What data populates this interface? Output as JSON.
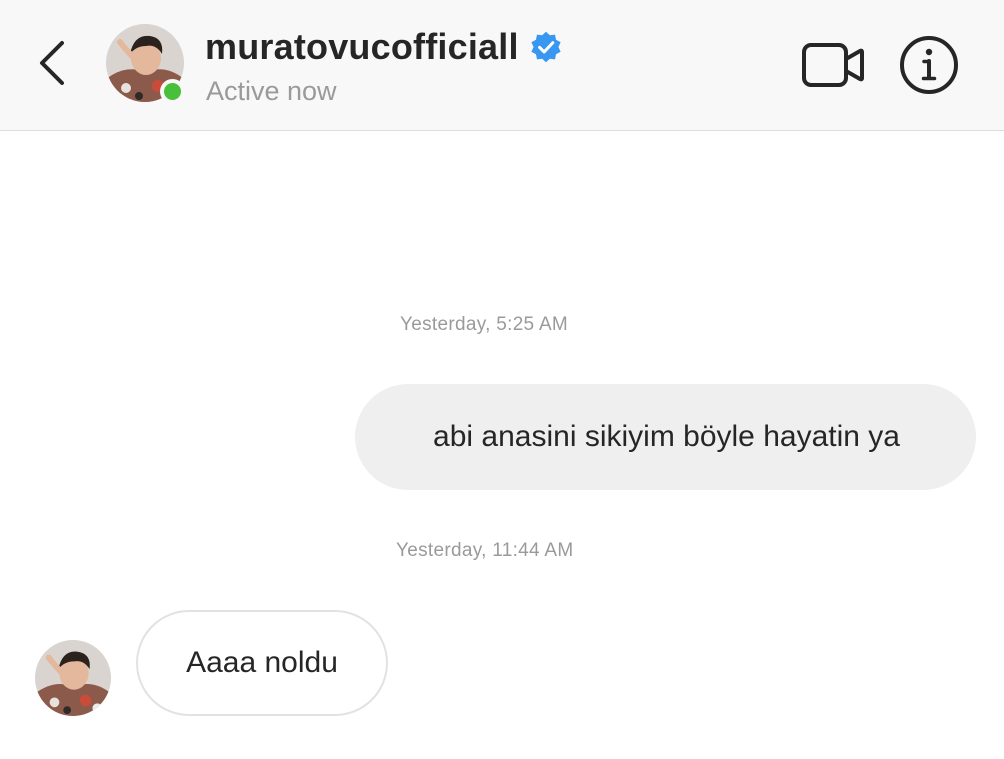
{
  "header": {
    "username": "muratovucofficiall",
    "status": "Active now",
    "icons": {
      "back": "chevron-left-icon",
      "verified": "verified-badge-icon",
      "video": "video-camera-icon",
      "info": "info-icon"
    },
    "colors": {
      "verified": "#3897f0",
      "online": "#49c03a"
    }
  },
  "messages": [
    {
      "timestamp": "Yesterday, 5:25 AM",
      "direction": "outgoing",
      "text": "abi anasini sikiyim böyle hayatin ya"
    },
    {
      "timestamp": "Yesterday, 11:44 AM",
      "direction": "incoming",
      "text": "Aaaa noldu"
    }
  ]
}
